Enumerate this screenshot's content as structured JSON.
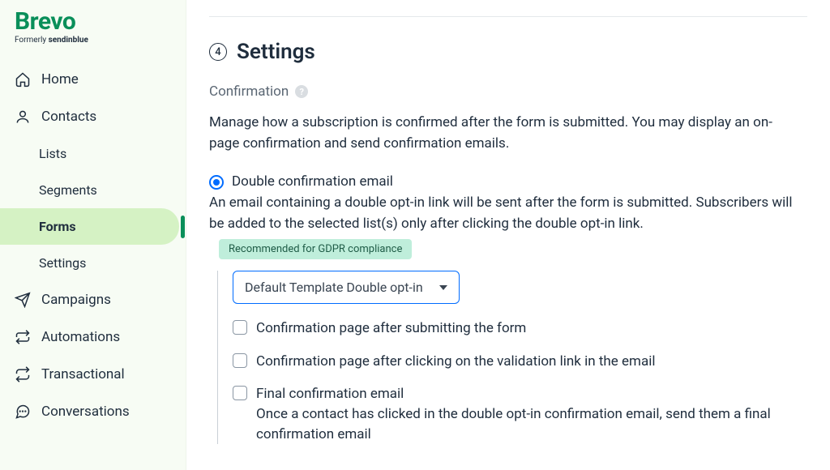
{
  "brand": {
    "name": "Brevo",
    "sub_prefix": "Formerly ",
    "sub_bold": "sendinblue"
  },
  "sidebar": {
    "items": [
      {
        "label": "Home",
        "icon": "home"
      },
      {
        "label": "Contacts",
        "icon": "user"
      },
      {
        "label": "Lists",
        "sub": true
      },
      {
        "label": "Segments",
        "sub": true
      },
      {
        "label": "Forms",
        "sub": true,
        "active": true
      },
      {
        "label": "Settings",
        "sub": true
      },
      {
        "label": "Campaigns",
        "icon": "send"
      },
      {
        "label": "Automations",
        "icon": "loop"
      },
      {
        "label": "Transactional",
        "icon": "repeat"
      },
      {
        "label": "Conversations",
        "icon": "chat"
      }
    ]
  },
  "main": {
    "step_number": "4",
    "step_title": "Settings",
    "section_label": "Confirmation",
    "description": "Manage how a subscription is confirmed after the form is submitted. You may display an on-page confirmation and send confirmation emails.",
    "radio": {
      "label": "Double confirmation email",
      "desc": " An email containing a double opt-in link will be sent after the form is submitted. Subscribers will be added to the selected list(s) only after clicking the double opt-in link."
    },
    "badge": "Recommended for GDPR compliance",
    "select_value": "Default Template Double opt-in",
    "checks": [
      {
        "label": "Confirmation page after submitting the form"
      },
      {
        "label": "Confirmation page after clicking on the validation link in the email"
      },
      {
        "label": "Final confirmation email",
        "sub": " Once a contact has clicked in the double opt-in confirmation email, send them a final confirmation email"
      }
    ]
  }
}
